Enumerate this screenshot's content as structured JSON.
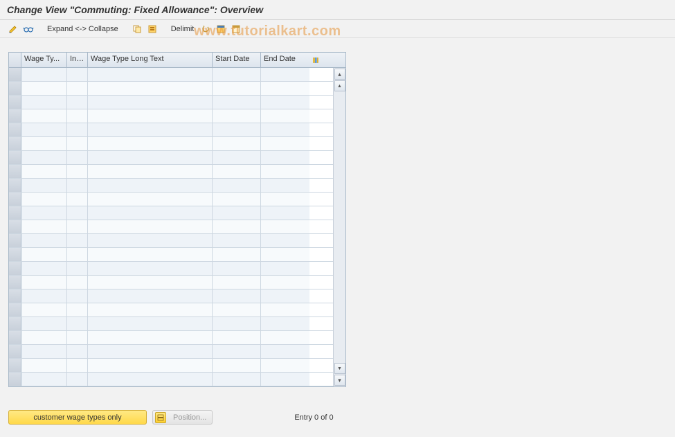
{
  "title": "Change View \"Commuting: Fixed Allowance\": Overview",
  "toolbar": {
    "expand_label": "Expand <-> Collapse",
    "delimit_label": "Delimit"
  },
  "watermark": "www.tutorialkart.com",
  "grid": {
    "columns": {
      "wage_type": "Wage Ty...",
      "inf": "Inf...",
      "long_text": "Wage Type Long Text",
      "start_date": "Start Date",
      "end_date": "End Date"
    },
    "row_count": 23
  },
  "footer": {
    "customer_wage_btn": "customer wage types only",
    "position_btn": "Position...",
    "entry_status": "Entry 0 of 0"
  },
  "icons": {
    "edit": "edit-pencil-icon",
    "glasses": "display-glasses-icon",
    "copy": "copy-icon",
    "select_all": "select-all-icon",
    "delete": "delete-row-icon",
    "save": "save-icon",
    "configure": "configure-columns-icon"
  }
}
